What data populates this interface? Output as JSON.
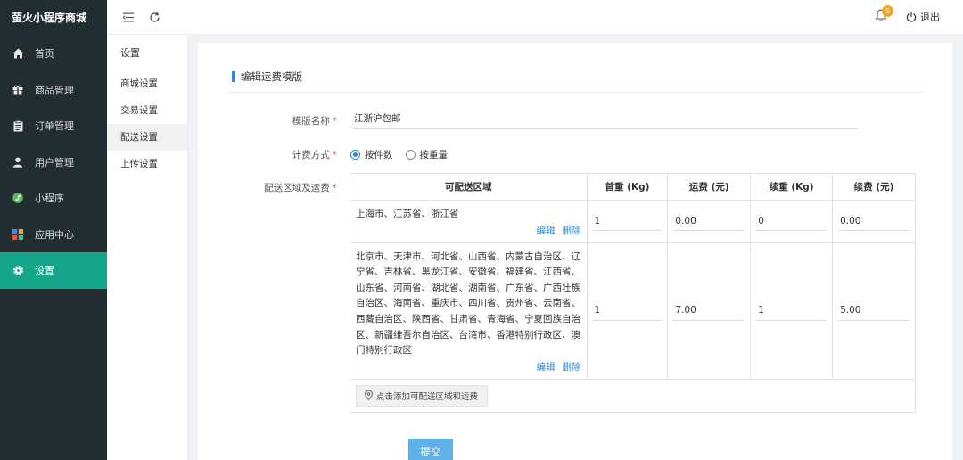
{
  "app": {
    "brand": "萤火小程序商城"
  },
  "sidebar": {
    "items": [
      {
        "label": "首页",
        "icon": "home-icon"
      },
      {
        "label": "商品管理",
        "icon": "gift-icon"
      },
      {
        "label": "订单管理",
        "icon": "clipboard-icon"
      },
      {
        "label": "用户管理",
        "icon": "user-icon"
      },
      {
        "label": "小程序",
        "icon": "miniprogram-icon"
      },
      {
        "label": "应用中心",
        "icon": "apps-icon"
      },
      {
        "label": "设置",
        "icon": "gear-icon",
        "active": true
      }
    ]
  },
  "topbar": {
    "notification_count": "5",
    "logout_label": "退出"
  },
  "subnav": {
    "title": "设置",
    "items": [
      {
        "label": "商城设置"
      },
      {
        "label": "交易设置"
      },
      {
        "label": "配送设置",
        "active": true
      },
      {
        "label": "上传设置"
      }
    ]
  },
  "form": {
    "section_title": "编辑运费模版",
    "name_label": "模版名称",
    "name_value": "江浙沪包邮",
    "billing_label": "计费方式",
    "billing_options": [
      {
        "label": "按件数",
        "checked": true
      },
      {
        "label": "按重量",
        "checked": false
      }
    ],
    "region_label": "配送区域及运费",
    "required_mark": "*",
    "submit_label": "提交"
  },
  "table": {
    "headers": [
      "可配送区域",
      "首重 (Kg)",
      "运费 (元)",
      "续重 (Kg)",
      "续费 (元)"
    ],
    "rows": [
      {
        "region": "上海市、江苏省、浙江省",
        "first_weight": "1",
        "fee": "0.00",
        "additional_weight": "0",
        "additional_fee": "0.00"
      },
      {
        "region": "北京市、天津市、河北省、山西省、内蒙古自治区、辽宁省、吉林省、黑龙江省、安徽省、福建省、江西省、山东省、河南省、湖北省、湖南省、广东省、广西壮族自治区、海南省、重庆市、四川省、贵州省、云南省、西藏自治区、陕西省、甘肃省、青海省、宁夏回族自治区、新疆维吾尔自治区、台湾市、香港特别行政区、澳门特别行政区",
        "first_weight": "1",
        "fee": "7.00",
        "additional_weight": "1",
        "additional_fee": "5.00"
      }
    ],
    "edit_label": "编辑",
    "delete_label": "删除",
    "add_region_label": "点击添加可配送区域和运费"
  },
  "colors": {
    "sidebar_bg": "#222d32",
    "active_green": "#15a58a",
    "accent_blue": "#2b8ad6",
    "submit_blue": "#5fb1e8"
  }
}
